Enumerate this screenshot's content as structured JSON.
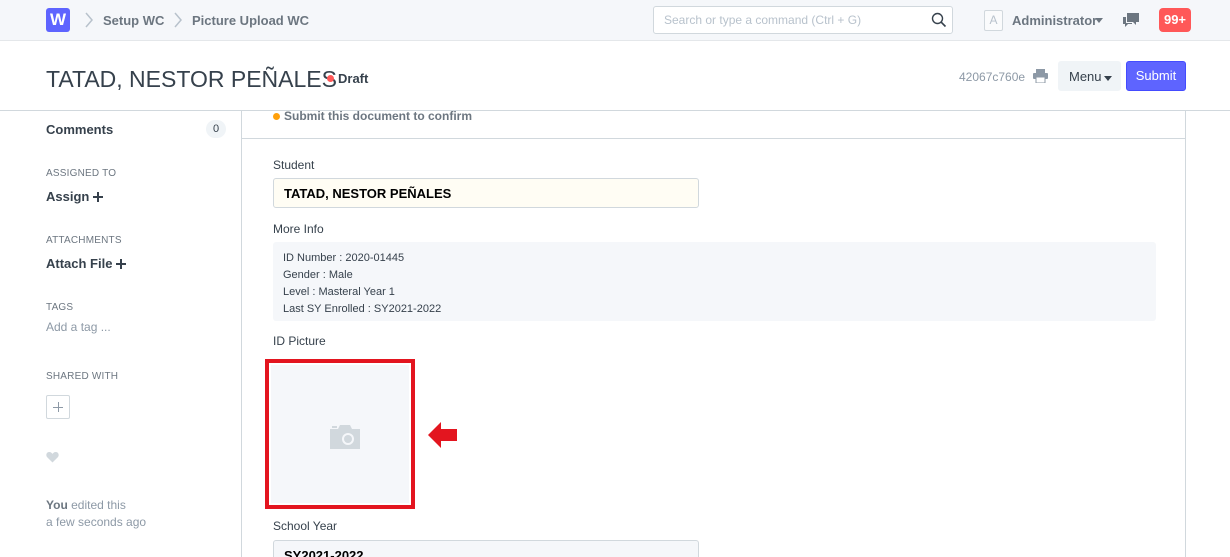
{
  "navbar": {
    "logo_letter": "W",
    "breadcrumbs": [
      "Setup WC",
      "Picture Upload WC"
    ],
    "search_placeholder": "Search or type a command (Ctrl + G)",
    "avatar_letter": "A",
    "user_name": "Administrator",
    "notification_count": "99+"
  },
  "page": {
    "title": "TATAD, NESTOR PEÑALES",
    "status": "Draft",
    "doc_id": "42067c760e",
    "menu_label": "Menu",
    "submit_label": "Submit"
  },
  "sidebar": {
    "comments_label": "Comments",
    "comments_count": "0",
    "assigned_to_label": "ASSIGNED TO",
    "assign_label": "Assign",
    "attachments_label": "ATTACHMENTS",
    "attach_label": "Attach File",
    "tags_label": "TAGS",
    "add_tag_label": "Add a tag ...",
    "shared_with_label": "SHARED WITH",
    "activity_user": "You",
    "activity_action": "edited this",
    "activity_time": "a few seconds ago"
  },
  "form": {
    "message": "Submit this document to confirm",
    "student_label": "Student",
    "student_value": "TATAD, NESTOR PEÑALES",
    "more_info_label": "More Info",
    "more_info_lines": [
      "ID Number : 2020-01445",
      "Gender : Male",
      "Level : Masteral Year 1",
      "Last SY Enrolled : SY2021-2022"
    ],
    "id_picture_label": "ID Picture",
    "school_year_label": "School Year",
    "school_year_value": "SY2021-2022"
  },
  "colors": {
    "primary": "#5e64ff",
    "draft_indicator": "#ff5858",
    "message_indicator": "#ffa00a",
    "highlight_annotation": "#e3151f",
    "notification_badge": "#ff5858"
  },
  "icons": [
    "search-icon",
    "chat-icon",
    "print-icon",
    "camera-icon",
    "heart-icon",
    "red-arrow-icon"
  ]
}
